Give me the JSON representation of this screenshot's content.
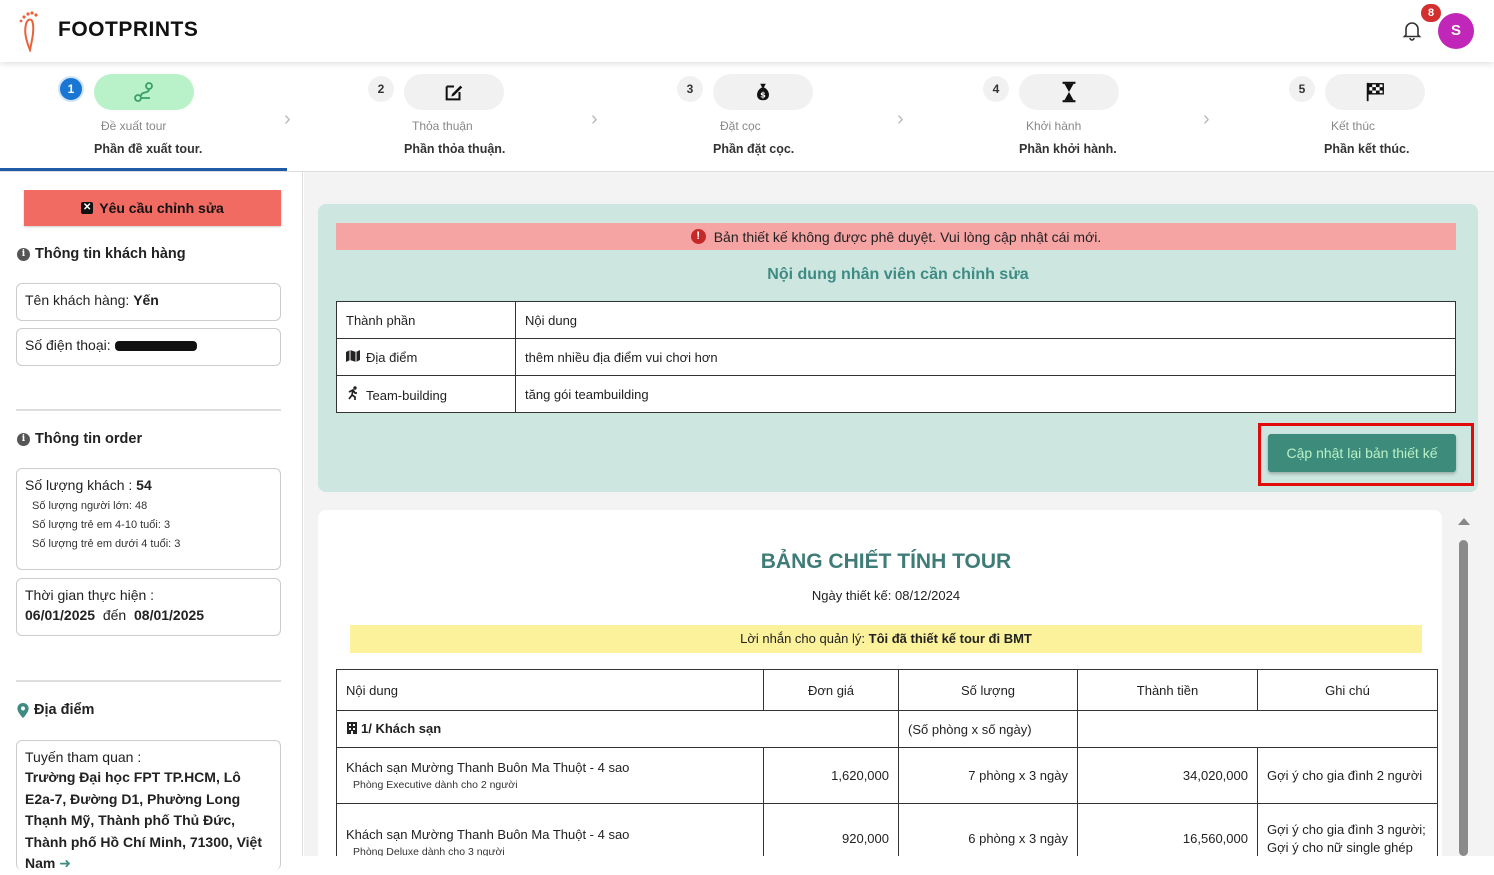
{
  "app": {
    "brand": "FOOTPRINTS",
    "notification_count": "8",
    "avatar_initial": "S"
  },
  "stepper": [
    {
      "num": "1",
      "label": "Đề xuất tour",
      "sub": "Phần đề xuất tour.",
      "icon": "route-icon",
      "active": true
    },
    {
      "num": "2",
      "label": "Thỏa thuận",
      "sub": "Phần thỏa thuận.",
      "icon": "edit-icon",
      "active": false
    },
    {
      "num": "3",
      "label": "Đặt cọc",
      "sub": "Phần đặt cọc.",
      "icon": "money-bag-icon",
      "active": false
    },
    {
      "num": "4",
      "label": "Khởi hành",
      "sub": "Phần khởi hành.",
      "icon": "hourglass-icon",
      "active": false
    },
    {
      "num": "5",
      "label": "Kết thúc",
      "sub": "Phần kết thúc.",
      "icon": "checkered-flag-icon",
      "active": false
    }
  ],
  "sidebar": {
    "request_button": "Yêu cầu chỉnh sửa",
    "customer_title": "Thông tin khách hàng",
    "customer_name_label": "Tên khách hàng:",
    "customer_name": "Yến",
    "phone_label": "Số điện thoại:",
    "order_title": "Thông tin order",
    "guests_label": "Số lượng khách :",
    "guests_total": "54",
    "adults": "Số lượng người lớn: 48",
    "kids_4_10": "Số lượng trẻ em 4-10 tuổi: 3",
    "kids_under_4": "Số lượng trẻ em dưới 4 tuổi: 3",
    "time_label": "Thời gian thực hiện :",
    "date_from": "06/01/2025",
    "date_to_word": "đến",
    "date_to": "08/01/2025",
    "location_title": "Địa điểm",
    "route_label": "Tuyến tham quan :",
    "route_text": "Trường Đại học FPT TP.HCM, Lô E2a-7, Đường D1, Phường Long Thạnh Mỹ, Thành phố Thủ Đức, Thành phố Hồ Chí Minh, 71300, Việt Nam"
  },
  "edit_panel": {
    "alert": "Bản thiết kế không được phê duyệt. Vui lòng cập nhật cái mới.",
    "title": "Nội dung nhân viên cần chỉnh sửa",
    "header": {
      "col1": "Thành phần",
      "col2": "Nội dung"
    },
    "rows": [
      {
        "component": "Địa điểm",
        "content": "thêm nhiều địa điểm vui chơi hơn",
        "icon": "map-icon"
      },
      {
        "component": "Team-building",
        "content": "tăng gói teambuilding",
        "icon": "running-icon"
      }
    ],
    "update_button": "Cập nhật lại bản thiết kế"
  },
  "quote": {
    "title": "BẢNG CHIẾT TÍNH TOUR",
    "date": "Ngày thiết kế: 08/12/2024",
    "note_label": "Lời nhắn cho quản lý:",
    "note_text": "Tôi đã thiết kế tour đi BMT",
    "headers": [
      "Nội dung",
      "Đơn giá",
      "Số lượng",
      "Thành tiền",
      "Ghi chú"
    ],
    "section": "1/ Khách sạn",
    "section_qty_note": "(Số phòng x số ngày)",
    "rows": [
      {
        "name": "Khách sạn Mường Thanh Buôn Ma Thuột - 4 sao",
        "sub": "Phòng Executive dành cho 2 người",
        "price": "1,620,000",
        "qty": "7 phòng x 3 ngày",
        "total": "34,020,000",
        "note": "Gợi ý cho gia đình 2 người"
      },
      {
        "name": "Khách sạn Mường Thanh Buôn Ma Thuột - 4 sao",
        "sub": "Phòng Deluxe dành cho 3 người",
        "price": "920,000",
        "qty": "6 phòng x 3 ngày",
        "total": "16,560,000",
        "note": "Gợi ý cho gia đình 3 người; Gợi ý cho nữ single ghép"
      }
    ]
  }
}
